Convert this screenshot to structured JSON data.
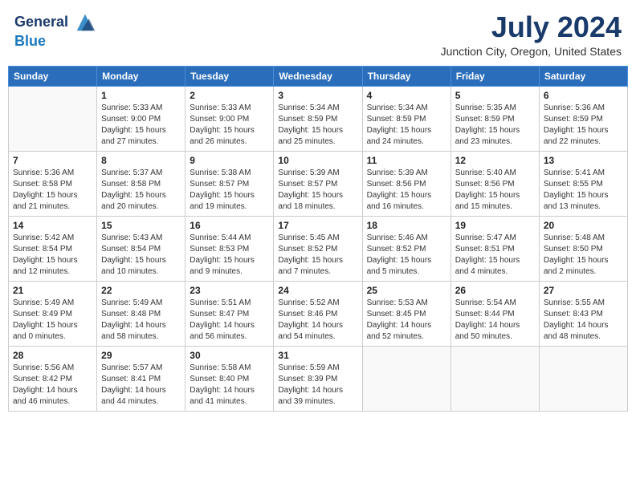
{
  "header": {
    "logo_line1": "General",
    "logo_line2": "Blue",
    "month_title": "July 2024",
    "location": "Junction City, Oregon, United States"
  },
  "weekdays": [
    "Sunday",
    "Monday",
    "Tuesday",
    "Wednesday",
    "Thursday",
    "Friday",
    "Saturday"
  ],
  "weeks": [
    [
      {
        "day": "",
        "info": ""
      },
      {
        "day": "1",
        "info": "Sunrise: 5:33 AM\nSunset: 9:00 PM\nDaylight: 15 hours\nand 27 minutes."
      },
      {
        "day": "2",
        "info": "Sunrise: 5:33 AM\nSunset: 9:00 PM\nDaylight: 15 hours\nand 26 minutes."
      },
      {
        "day": "3",
        "info": "Sunrise: 5:34 AM\nSunset: 8:59 PM\nDaylight: 15 hours\nand 25 minutes."
      },
      {
        "day": "4",
        "info": "Sunrise: 5:34 AM\nSunset: 8:59 PM\nDaylight: 15 hours\nand 24 minutes."
      },
      {
        "day": "5",
        "info": "Sunrise: 5:35 AM\nSunset: 8:59 PM\nDaylight: 15 hours\nand 23 minutes."
      },
      {
        "day": "6",
        "info": "Sunrise: 5:36 AM\nSunset: 8:59 PM\nDaylight: 15 hours\nand 22 minutes."
      }
    ],
    [
      {
        "day": "7",
        "info": "Sunrise: 5:36 AM\nSunset: 8:58 PM\nDaylight: 15 hours\nand 21 minutes."
      },
      {
        "day": "8",
        "info": "Sunrise: 5:37 AM\nSunset: 8:58 PM\nDaylight: 15 hours\nand 20 minutes."
      },
      {
        "day": "9",
        "info": "Sunrise: 5:38 AM\nSunset: 8:57 PM\nDaylight: 15 hours\nand 19 minutes."
      },
      {
        "day": "10",
        "info": "Sunrise: 5:39 AM\nSunset: 8:57 PM\nDaylight: 15 hours\nand 18 minutes."
      },
      {
        "day": "11",
        "info": "Sunrise: 5:39 AM\nSunset: 8:56 PM\nDaylight: 15 hours\nand 16 minutes."
      },
      {
        "day": "12",
        "info": "Sunrise: 5:40 AM\nSunset: 8:56 PM\nDaylight: 15 hours\nand 15 minutes."
      },
      {
        "day": "13",
        "info": "Sunrise: 5:41 AM\nSunset: 8:55 PM\nDaylight: 15 hours\nand 13 minutes."
      }
    ],
    [
      {
        "day": "14",
        "info": "Sunrise: 5:42 AM\nSunset: 8:54 PM\nDaylight: 15 hours\nand 12 minutes."
      },
      {
        "day": "15",
        "info": "Sunrise: 5:43 AM\nSunset: 8:54 PM\nDaylight: 15 hours\nand 10 minutes."
      },
      {
        "day": "16",
        "info": "Sunrise: 5:44 AM\nSunset: 8:53 PM\nDaylight: 15 hours\nand 9 minutes."
      },
      {
        "day": "17",
        "info": "Sunrise: 5:45 AM\nSunset: 8:52 PM\nDaylight: 15 hours\nand 7 minutes."
      },
      {
        "day": "18",
        "info": "Sunrise: 5:46 AM\nSunset: 8:52 PM\nDaylight: 15 hours\nand 5 minutes."
      },
      {
        "day": "19",
        "info": "Sunrise: 5:47 AM\nSunset: 8:51 PM\nDaylight: 15 hours\nand 4 minutes."
      },
      {
        "day": "20",
        "info": "Sunrise: 5:48 AM\nSunset: 8:50 PM\nDaylight: 15 hours\nand 2 minutes."
      }
    ],
    [
      {
        "day": "21",
        "info": "Sunrise: 5:49 AM\nSunset: 8:49 PM\nDaylight: 15 hours\nand 0 minutes."
      },
      {
        "day": "22",
        "info": "Sunrise: 5:49 AM\nSunset: 8:48 PM\nDaylight: 14 hours\nand 58 minutes."
      },
      {
        "day": "23",
        "info": "Sunrise: 5:51 AM\nSunset: 8:47 PM\nDaylight: 14 hours\nand 56 minutes."
      },
      {
        "day": "24",
        "info": "Sunrise: 5:52 AM\nSunset: 8:46 PM\nDaylight: 14 hours\nand 54 minutes."
      },
      {
        "day": "25",
        "info": "Sunrise: 5:53 AM\nSunset: 8:45 PM\nDaylight: 14 hours\nand 52 minutes."
      },
      {
        "day": "26",
        "info": "Sunrise: 5:54 AM\nSunset: 8:44 PM\nDaylight: 14 hours\nand 50 minutes."
      },
      {
        "day": "27",
        "info": "Sunrise: 5:55 AM\nSunset: 8:43 PM\nDaylight: 14 hours\nand 48 minutes."
      }
    ],
    [
      {
        "day": "28",
        "info": "Sunrise: 5:56 AM\nSunset: 8:42 PM\nDaylight: 14 hours\nand 46 minutes."
      },
      {
        "day": "29",
        "info": "Sunrise: 5:57 AM\nSunset: 8:41 PM\nDaylight: 14 hours\nand 44 minutes."
      },
      {
        "day": "30",
        "info": "Sunrise: 5:58 AM\nSunset: 8:40 PM\nDaylight: 14 hours\nand 41 minutes."
      },
      {
        "day": "31",
        "info": "Sunrise: 5:59 AM\nSunset: 8:39 PM\nDaylight: 14 hours\nand 39 minutes."
      },
      {
        "day": "",
        "info": ""
      },
      {
        "day": "",
        "info": ""
      },
      {
        "day": "",
        "info": ""
      }
    ]
  ]
}
